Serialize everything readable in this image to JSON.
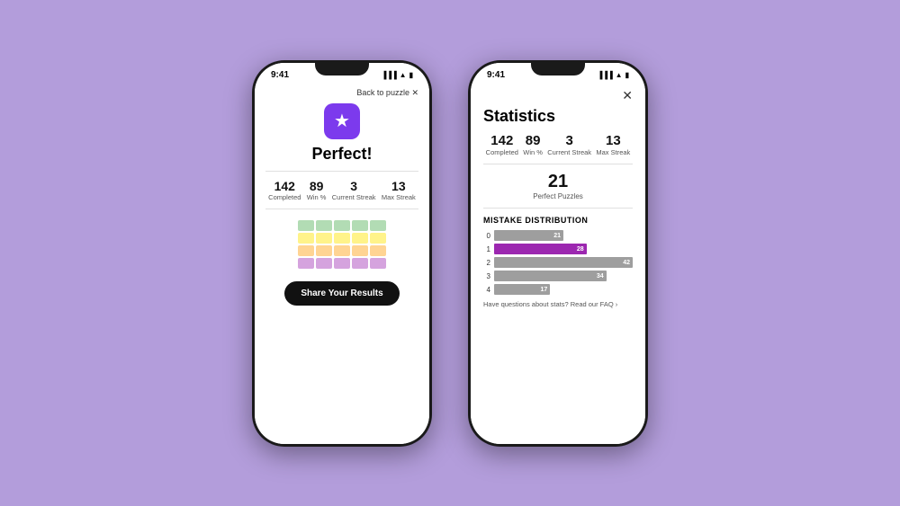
{
  "background_color": "#b39ddb",
  "phone1": {
    "status_time": "9:41",
    "back_link": "Back to puzzle ✕",
    "star_icon": "★",
    "title": "Perfect!",
    "stats": [
      {
        "number": "142",
        "label": "Completed"
      },
      {
        "number": "89",
        "label": "Win %"
      },
      {
        "number": "3",
        "label": "Current\nStreak"
      },
      {
        "number": "13",
        "label": "Max\nStreak"
      }
    ],
    "share_button": "Share Your Results",
    "tile_colors": [
      [
        "#a5d6a7",
        "#a5d6a7",
        "#a5d6a7",
        "#a5d6a7",
        "#a5d6a7"
      ],
      [
        "#fff176",
        "#fff176",
        "#fff176",
        "#fff176",
        "#fff176"
      ],
      [
        "#ffcc80",
        "#ffcc80",
        "#ffcc80",
        "#ffcc80",
        "#ffcc80"
      ],
      [
        "#ce93d8",
        "#ce93d8",
        "#ce93d8",
        "#ce93d8",
        "#ce93d8"
      ]
    ]
  },
  "phone2": {
    "status_time": "9:41",
    "close_icon": "✕",
    "title": "Statistics",
    "stats": [
      {
        "number": "142",
        "label": "Completed"
      },
      {
        "number": "89",
        "label": "Win %"
      },
      {
        "number": "3",
        "label": "Current\nStreak"
      },
      {
        "number": "13",
        "label": "Max\nStreak"
      }
    ],
    "perfect_puzzles_number": "21",
    "perfect_puzzles_label": "Perfect Puzzles",
    "mistake_distribution_title": "MISTAKE DISTRIBUTION",
    "bars": [
      {
        "label": "0",
        "value": 21,
        "max": 42,
        "color": "gray"
      },
      {
        "label": "1",
        "value": 28,
        "max": 42,
        "color": "purple"
      },
      {
        "label": "2",
        "value": 42,
        "max": 42,
        "color": "gray"
      },
      {
        "label": "3",
        "value": 34,
        "max": 42,
        "color": "gray"
      },
      {
        "label": "4",
        "value": 17,
        "max": 42,
        "color": "gray"
      }
    ],
    "faq_text": "Have questions about stats? Read our FAQ ›"
  }
}
